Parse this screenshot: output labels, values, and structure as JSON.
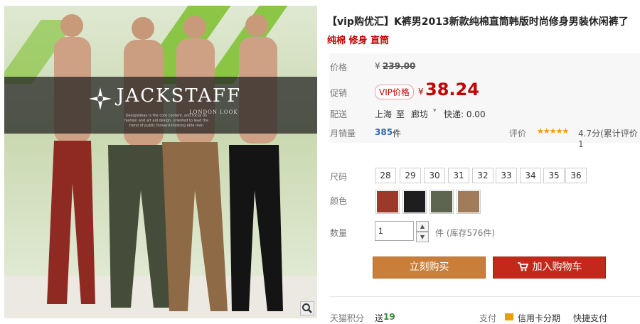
{
  "photo": {
    "brand": "JACKSTAFF",
    "brand_sub": "LONDON LOOK",
    "brand_desc": "Designideas is the core content, and focus on fashion and art aid design, oriented to lead the trend of public forward-thinking elite men",
    "zoom_icon": "magnifier-icon"
  },
  "title": "【vip购优汇】K裤男2013新款纯棉直筒韩版时尚修身男装休闲裤了",
  "subtitle": "纯棉 修身 直筒",
  "price_row": {
    "label": "价格",
    "currency": "¥",
    "original": "239.00"
  },
  "promo_row": {
    "label": "促销",
    "vip_tag": "VIP价格",
    "currency": "¥",
    "price": "38.24"
  },
  "ship_row": {
    "label": "配送",
    "from": "上海",
    "to_word": "至",
    "to": "廊坊",
    "arrow": "▾",
    "express": "快递: 0.00"
  },
  "sales_row": {
    "label": "月销量",
    "count": "385",
    "unit": "件"
  },
  "review": {
    "label": "评价",
    "stars": "★★★★★",
    "score": "4.7分(累计评价1"
  },
  "size_row": {
    "label": "尺码",
    "sizes": [
      "28",
      "29",
      "30",
      "31",
      "32",
      "33",
      "34",
      "35",
      "36"
    ]
  },
  "color_row": {
    "label": "颜色",
    "swatches": [
      "#9b3a2a",
      "#1e1e1e",
      "#5d6450",
      "#a07c5a"
    ]
  },
  "qty_row": {
    "label": "数量",
    "value": "1",
    "stock": "件 (库存576件)",
    "up": "▲",
    "down": "▼"
  },
  "buttons": {
    "buy": "立刻购买",
    "cart": "加入购物车",
    "cart_icon": "cart-icon"
  },
  "bottom": {
    "points_label": "天猫积分",
    "points_prefix": "送",
    "points": "19",
    "pay_label": "支付",
    "pay_method": "信用卡分期",
    "quick": "快捷支付"
  }
}
